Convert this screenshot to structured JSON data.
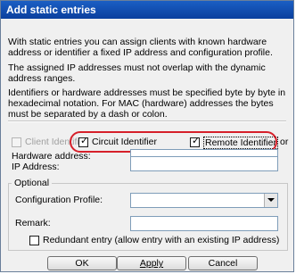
{
  "dialog": {
    "title": "Add static entries"
  },
  "description": {
    "p1": "With static entries you can assign clients with known hardware address or identifier a fixed IP address and configuration profile.",
    "p2": "The assigned IP addresses must not overlap with the dynamic address ranges.",
    "p3": "Identifiers or hardware addresses must be specified byte by byte in hexadecimal notation. For MAC (hardware) addresses the bytes must be separated by a dash or colon."
  },
  "identifiers": {
    "client_identifier": {
      "label": "Client Identifier",
      "checked": false,
      "enabled": false
    },
    "circuit_identifier": {
      "label": "Circuit Identifier",
      "checked": true
    },
    "remote_identifier": {
      "label": "Remote Identifier",
      "checked": true
    },
    "or_label": "or",
    "hardware_address_label": "Hardware address:",
    "hardware_address_value": ""
  },
  "ip": {
    "label": "IP Address:",
    "value": ""
  },
  "optional": {
    "title": "Optional",
    "config_profile_label": "Configuration Profile:",
    "config_profile_value": "",
    "remark_label": "Remark:",
    "remark_value": "",
    "redundant_label": "Redundant entry (allow entry with an existing IP address)",
    "redundant_checked": false
  },
  "buttons": {
    "ok": "OK",
    "apply": "Apply",
    "cancel": "Cancel"
  },
  "colors": {
    "title_bar": "#0a3f9e",
    "highlight": "#d6202a"
  }
}
